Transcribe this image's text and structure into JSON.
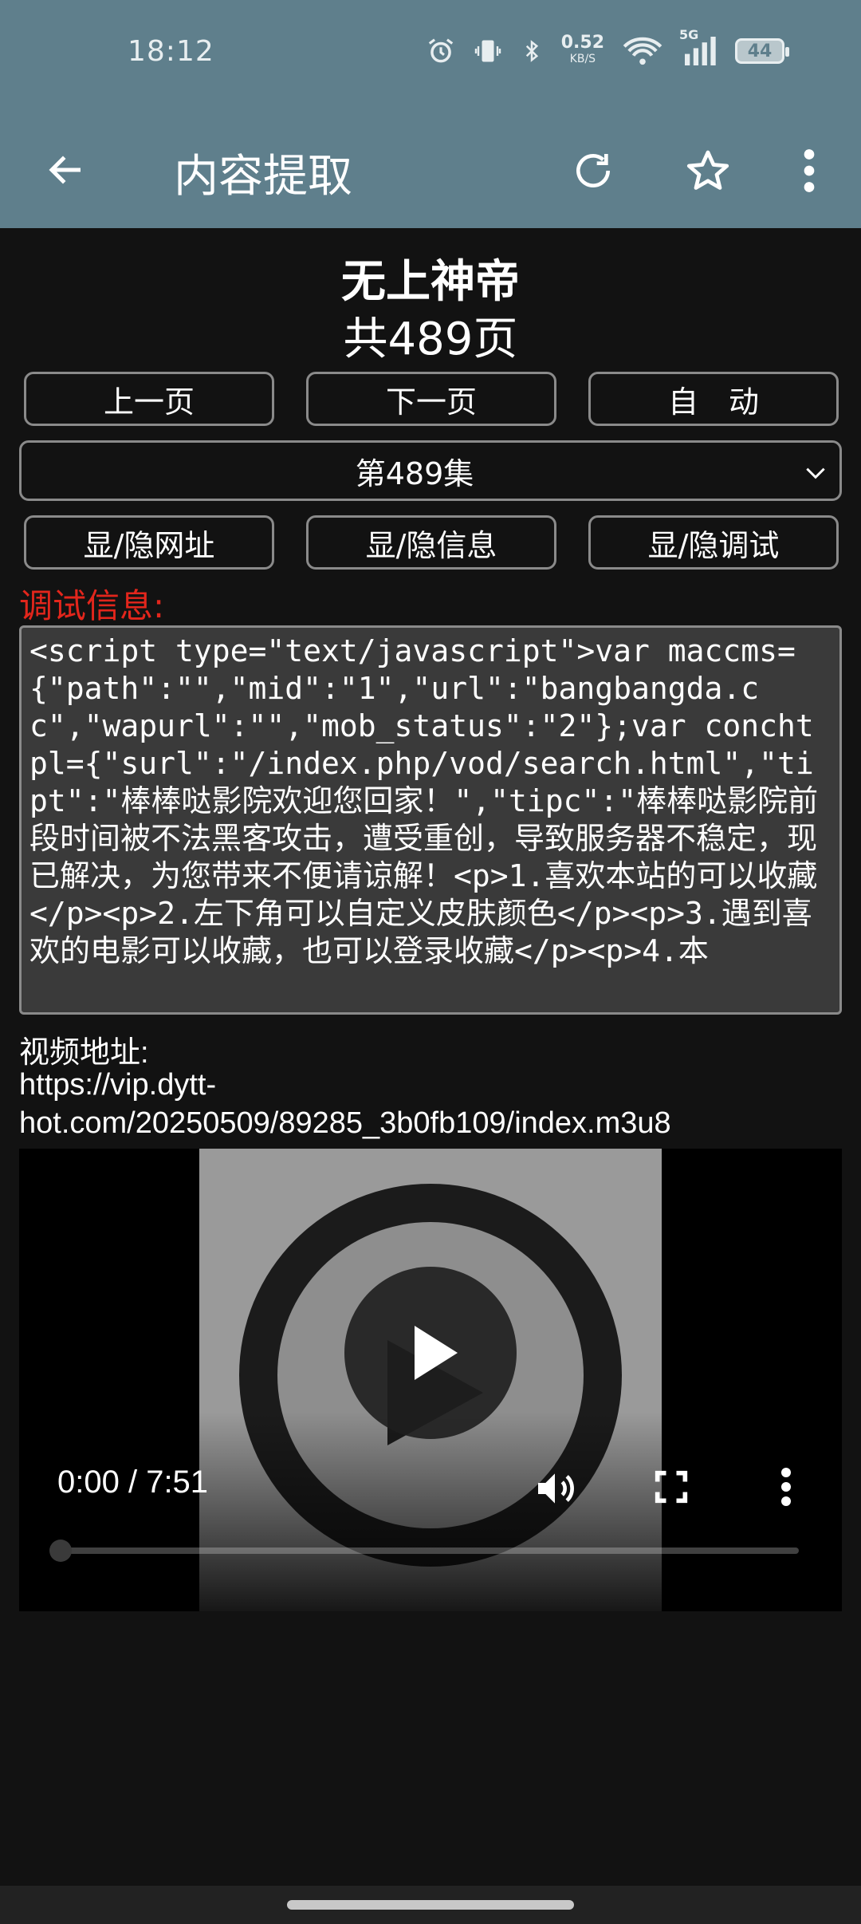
{
  "status_bar": {
    "time": "18:12",
    "net_speed_value": "0.52",
    "net_speed_unit": "KB/S",
    "network_type": "5G",
    "battery": "44"
  },
  "app_bar": {
    "title": "内容提取",
    "icons": [
      "back-arrow-icon",
      "reload-icon",
      "star-icon",
      "more-vert-icon"
    ]
  },
  "header": {
    "title": "无上神帝",
    "page_count": "共489页"
  },
  "nav_buttons": {
    "prev": "上一页",
    "next": "下一页",
    "auto": "自　动"
  },
  "episode_select": {
    "selected": "第489集"
  },
  "toggle_buttons": {
    "url": "显/隐网址",
    "info": "显/隐信息",
    "debug": "显/隐调试"
  },
  "debug": {
    "label": "调试信息:",
    "text": "<script type=\"text/javascript\">var maccms={\"path\":\"\",\"mid\":\"1\",\"url\":\"bangbangda.cc\",\"wapurl\":\"\",\"mob_status\":\"2\"};var conchtpl={\"surl\":\"/index.php/vod/search.html\",\"tipt\":\"棒棒哒影院欢迎您回家！\",\"tipc\":\"棒棒哒影院前段时间被不法黑客攻击，遭受重创，导致服务器不稳定，现已解决，为您带来不便请谅解！<p>1.喜欢本站的可以收藏</p><p>2.左下角可以自定义皮肤颜色</p><p>3.遇到喜欢的电影可以收藏，也可以登录收藏</p><p>4.本"
  },
  "video": {
    "label": "视频地址:",
    "url": " https://vip.dytt-hot.com/20250509/89285_3b0fb109/index.m3u8",
    "time": "0:00 / 7:51",
    "progress": 0
  },
  "colors": {
    "app_bar": "#5f7f8c",
    "background": "#121212",
    "debug_label": "#e3261c",
    "debug_box": "#3a3a3a"
  }
}
